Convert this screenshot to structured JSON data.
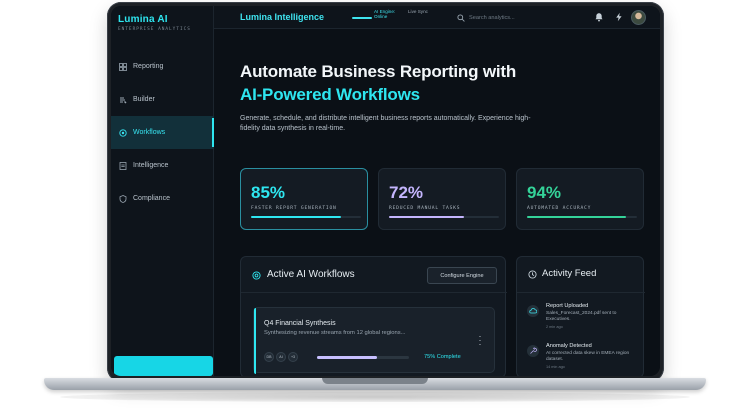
{
  "colors": {
    "accent": "#2ee6f0",
    "stat_green": "#34d399",
    "stat_purple": "#c4b5fd",
    "background": "#0b1016"
  },
  "sidebar": {
    "brand": "Lumina AI",
    "brand_sub": "ENTERPRISE ANALYTICS",
    "items": [
      {
        "label": "Reporting",
        "icon": "grid-icon",
        "active": false
      },
      {
        "label": "Builder",
        "icon": "build-icon",
        "active": false
      },
      {
        "label": "Workflows",
        "icon": "workflow-icon",
        "active": true
      },
      {
        "label": "Intelligence",
        "icon": "document-icon",
        "active": false
      },
      {
        "label": "Compliance",
        "icon": "shield-icon",
        "active": false
      }
    ]
  },
  "topbar": {
    "title": "Lumina Intelligence",
    "status": "AI Engine: Online",
    "sync": "Live Sync",
    "search_placeholder": "Search analytics...",
    "icons": [
      "bell-icon",
      "bolt-icon"
    ]
  },
  "hero": {
    "line1": "Automate Business Reporting with",
    "line2": "AI-Powered Workflows",
    "description": "Generate, schedule, and distribute intelligent business reports automatically. Experience high-fidelity data synthesis in real-time."
  },
  "stats": [
    {
      "value": "85%",
      "label": "FASTER REPORT GENERATION",
      "progress": 0.82,
      "color": "#2ee6f0"
    },
    {
      "value": "72%",
      "label": "REDUCED MANUAL TASKS",
      "progress": 0.68,
      "color": "#c4b5fd"
    },
    {
      "value": "94%",
      "label": "AUTOMATED ACCURACY",
      "progress": 0.9,
      "color": "#34d399"
    }
  ],
  "workflows": {
    "title": "Active AI Workflows",
    "button": "Configure Engine",
    "card": {
      "title": "Q4 Financial Synthesis",
      "description": "Synthesizing revenue streams from 12 global regions...",
      "chips": [
        "DB",
        "AI",
        "+3"
      ],
      "progress": 0.65,
      "progress_label": "75% Complete"
    }
  },
  "activity": {
    "title": "Activity Feed",
    "items": [
      {
        "title": "Report Uploaded",
        "desc": "Sales_Forecast_2024.pdf sent to Executives.",
        "time": "2 min ago",
        "icon": "cloud-upload-icon"
      },
      {
        "title": "Anomaly Detected",
        "desc": "AI corrected data skew in EMEA region dataset.",
        "time": "14 min ago",
        "icon": "wrench-icon"
      }
    ]
  }
}
